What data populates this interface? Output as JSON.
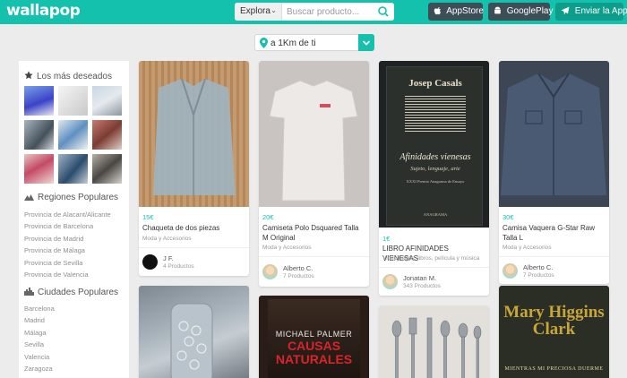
{
  "header": {
    "logo_text": "wallapop",
    "search": {
      "category_label": "Explora",
      "placeholder": "Buscar producto..."
    },
    "appstore_label": "AppStore",
    "googleplay_label": "GooglePlay",
    "send_app_label": "Enviar la App"
  },
  "location": {
    "label": "a 1Km de ti"
  },
  "sidebar": {
    "favorites_title": "Los más deseados",
    "regions_title": "Regiones Populares",
    "regions": [
      "Provincia de Alacant/Alicante",
      "Provincia de Barcelona",
      "Provincia de Madrid",
      "Provincia de Málaga",
      "Provincia de Sevilla",
      "Provincia de Valencia"
    ],
    "cities_title": "Ciudades Populares",
    "cities": [
      "Barcelona",
      "Madrid",
      "Málaga",
      "Sevilla",
      "Valencia",
      "Zaragoza"
    ]
  },
  "products": [
    {
      "price": "15€",
      "title": "Chaqueta de dos piezas",
      "category": "Moda y Accesorios",
      "user": "J F.",
      "user_count": "4 Productos"
    },
    {
      "price": "20€",
      "title": "Camiseta Polo Dsquared Talla M Original",
      "category": "Moda y Accesorios",
      "user": "Alberto C.",
      "user_count": "7 Productos"
    },
    {
      "price": "1€",
      "title": "LIBRO AFINIDADES VIENESAS",
      "category": "Videojuegos, libros, película y música",
      "user": "Jonatan M.",
      "user_count": "343 Productos",
      "book_author": "Josep Casals",
      "book_title": "Afinidades vienesas",
      "book_subtitle": "Sujeto, lenguaje, arte",
      "book_prize": "XXXI Premio Anagrama de Ensayo",
      "book_publisher": "ANAGRAMA"
    },
    {
      "price": "30€",
      "title": "Camisa Vaquera G-Star Raw Talla L",
      "category": "Moda y Accesorios",
      "user": "Alberto C.",
      "user_count": "7 Productos"
    },
    {},
    {
      "book_author": "MICHAEL PALMER",
      "book_title": "CAUSAS NATURALES"
    },
    {},
    {
      "book_author": "Mary Higgins Clark",
      "book_title": "MIENTRAS MI PRECIOSA DUERME"
    }
  ],
  "colors": {
    "brand": "#13c1ac",
    "dark_button": "#3d4e57",
    "background": "#ececec"
  }
}
